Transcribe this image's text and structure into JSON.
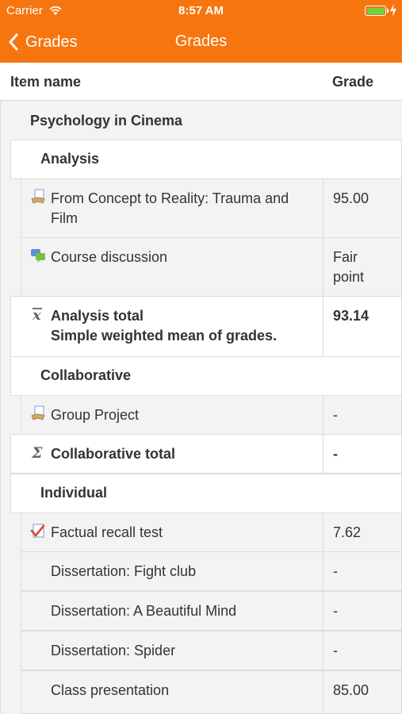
{
  "status": {
    "carrier": "Carrier",
    "time": "8:57 AM"
  },
  "nav": {
    "back_label": "Grades",
    "title": "Grades"
  },
  "columns": {
    "item_name": "Item name",
    "grade": "Grade"
  },
  "course": "Psychology in Cinema",
  "categories": {
    "analysis": {
      "title": "Analysis",
      "items": [
        {
          "name": "From Concept to Reality: Trauma and Film",
          "grade": "95.00",
          "icon": "assignment-icon"
        },
        {
          "name": "Course discussion",
          "grade": "Fair point",
          "icon": "forum-icon"
        }
      ],
      "total": {
        "name": "Analysis total",
        "subtitle": "Simple weighted mean of grades.",
        "grade": "93.14",
        "icon": "mean-icon"
      }
    },
    "collaborative": {
      "title": "Collaborative",
      "items": [
        {
          "name": "Group Project",
          "grade": "-",
          "icon": "assignment-icon"
        }
      ],
      "total": {
        "name": "Collaborative total",
        "grade": "-",
        "icon": "sum-icon"
      }
    },
    "individual": {
      "title": "Individual",
      "items": [
        {
          "name": "Factual recall test",
          "grade": "7.62",
          "icon": "quiz-icon"
        },
        {
          "name": "Dissertation: Fight club",
          "grade": "-"
        },
        {
          "name": "Dissertation: A Beautiful Mind",
          "grade": "-"
        },
        {
          "name": "Dissertation: Spider",
          "grade": "-"
        },
        {
          "name": "Class presentation",
          "grade": "85.00"
        }
      ]
    }
  },
  "colors": {
    "brand": "#f7750f",
    "battery": "#6fd337"
  }
}
